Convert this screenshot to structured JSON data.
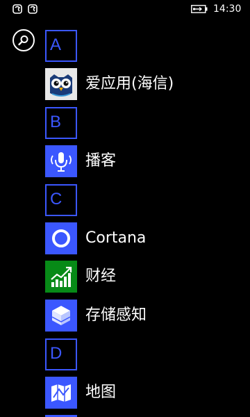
{
  "status_bar": {
    "time": "14:30",
    "notification_icons": [
      "app-notification-icon",
      "app-notification-icon"
    ],
    "battery_icon": "battery-charging-icon"
  },
  "search": {
    "icon": "search-icon"
  },
  "accent_color": "#3b57ff",
  "sections": [
    {
      "letter": "A",
      "apps": [
        {
          "label": "爱应用(海信)",
          "icon": "owl-icon",
          "tile_color": "#e8e8e8"
        }
      ]
    },
    {
      "letter": "B",
      "apps": [
        {
          "label": "播客",
          "icon": "podcast-microphone-icon",
          "tile_color": "#3b57ff"
        }
      ]
    },
    {
      "letter": "C",
      "apps": [
        {
          "label": "Cortana",
          "icon": "cortana-ring-icon",
          "tile_color": "#3b57ff"
        },
        {
          "label": "财经",
          "icon": "finance-chart-icon",
          "tile_color": "#078a17"
        },
        {
          "label": "存储感知",
          "icon": "storage-sense-icon",
          "tile_color": "#3b57ff"
        }
      ]
    },
    {
      "letter": "D",
      "apps": [
        {
          "label": "地图",
          "icon": "map-icon",
          "tile_color": "#3b57ff"
        }
      ]
    }
  ]
}
